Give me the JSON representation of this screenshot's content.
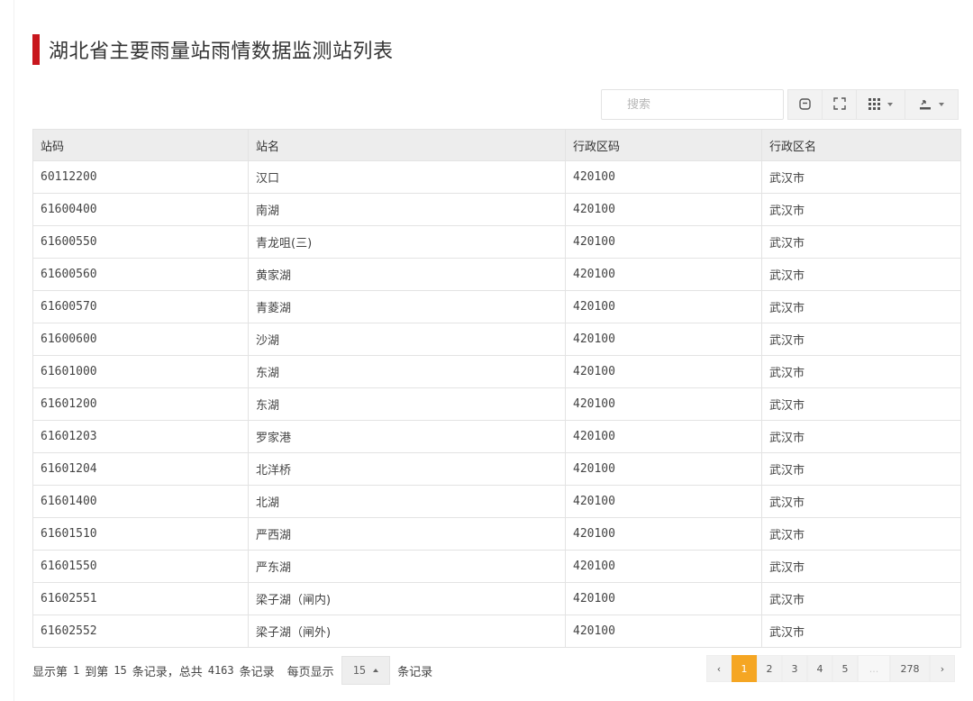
{
  "page": {
    "title": "湖北省主要雨量站雨情数据监测站列表"
  },
  "toolbar": {
    "search_placeholder": "搜索",
    "buttons": [
      {
        "name": "toggle-view",
        "icon": "toggle-icon"
      },
      {
        "name": "fullscreen",
        "icon": "fullscreen-icon"
      },
      {
        "name": "columns",
        "icon": "columns-grid-icon",
        "dropdown": true
      },
      {
        "name": "export",
        "icon": "export-icon",
        "dropdown": true
      }
    ]
  },
  "table": {
    "headers": [
      "站码",
      "站名",
      "行政区码",
      "行政区名"
    ],
    "rows": [
      [
        "60112200",
        "汉口",
        "420100",
        "武汉市"
      ],
      [
        "61600400",
        "南湖",
        "420100",
        "武汉市"
      ],
      [
        "61600550",
        "青龙咀(三)",
        "420100",
        "武汉市"
      ],
      [
        "61600560",
        "黄家湖",
        "420100",
        "武汉市"
      ],
      [
        "61600570",
        "青菱湖",
        "420100",
        "武汉市"
      ],
      [
        "61600600",
        "沙湖",
        "420100",
        "武汉市"
      ],
      [
        "61601000",
        "东湖",
        "420100",
        "武汉市"
      ],
      [
        "61601200",
        "东湖",
        "420100",
        "武汉市"
      ],
      [
        "61601203",
        "罗家港",
        "420100",
        "武汉市"
      ],
      [
        "61601204",
        "北洋桥",
        "420100",
        "武汉市"
      ],
      [
        "61601400",
        "北湖",
        "420100",
        "武汉市"
      ],
      [
        "61601510",
        "严西湖",
        "420100",
        "武汉市"
      ],
      [
        "61601550",
        "严东湖",
        "420100",
        "武汉市"
      ],
      [
        "61602551",
        "梁子湖（闸内)",
        "420100",
        "武汉市"
      ],
      [
        "61602552",
        "梁子湖（闸外)",
        "420100",
        "武汉市"
      ]
    ]
  },
  "footer": {
    "show_prefix": "显示第",
    "from": "1",
    "to_label": "到第",
    "to": "15",
    "records_total_label": "条记录，总共",
    "total": "4163",
    "records_label": "条记录",
    "per_page_label": "每页显示",
    "page_size": "15",
    "per_page_suffix": "条记录"
  },
  "pagination": {
    "prev": "‹",
    "pages": [
      "1",
      "2",
      "3",
      "4",
      "5"
    ],
    "current": "1",
    "ellipsis": "...",
    "last": "278",
    "next": "›"
  },
  "colors": {
    "accent": "#c8161d",
    "active_page": "#f5a623",
    "header_bg": "#ededed"
  }
}
